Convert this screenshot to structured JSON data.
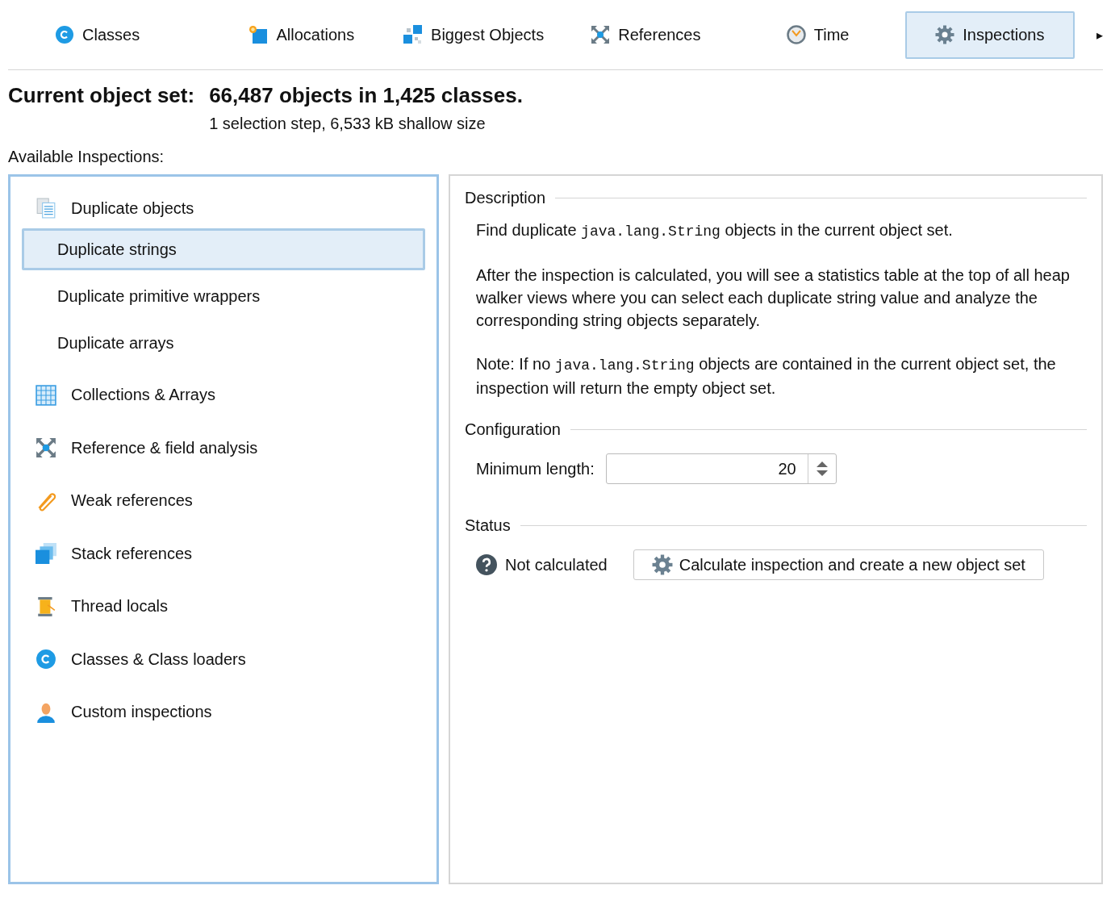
{
  "tabs": [
    {
      "label": "Classes",
      "selected": false
    },
    {
      "label": "Allocations",
      "selected": false
    },
    {
      "label": "Biggest Objects",
      "selected": false
    },
    {
      "label": "References",
      "selected": false
    },
    {
      "label": "Time",
      "selected": false
    },
    {
      "label": "Inspections",
      "selected": true
    }
  ],
  "tab_overflow": "▸",
  "header": {
    "label": "Current object set:",
    "summary": "66,487 objects in 1,425 classes.",
    "detail": "1 selection step, 6,533 kB shallow size"
  },
  "inspections": {
    "label": "Available Inspections:",
    "items": [
      {
        "label": "Duplicate objects",
        "selected": false,
        "children": [
          {
            "label": "Duplicate strings",
            "selected": true
          },
          {
            "label": "Duplicate primitive wrappers",
            "selected": false
          },
          {
            "label": "Duplicate arrays",
            "selected": false
          }
        ]
      },
      {
        "label": "Collections & Arrays",
        "selected": false
      },
      {
        "label": "Reference & field analysis",
        "selected": false
      },
      {
        "label": "Weak references",
        "selected": false
      },
      {
        "label": "Stack references",
        "selected": false
      },
      {
        "label": "Thread locals",
        "selected": false
      },
      {
        "label": "Classes & Class loaders",
        "selected": false
      },
      {
        "label": "Custom inspections",
        "selected": false
      }
    ]
  },
  "description": {
    "title": "Description",
    "paragraphs": [
      [
        {
          "kind": "text",
          "text": "Find duplicate "
        },
        {
          "kind": "code",
          "text": "java.lang.String"
        },
        {
          "kind": "text",
          "text": " objects in the current object set."
        }
      ],
      [
        {
          "kind": "text",
          "text": "After the inspection is calculated, you will see a statistics table at the top of all heap walker views where you can select each duplicate string value and analyze the corresponding string objects separately."
        }
      ],
      [
        {
          "kind": "text",
          "text": "Note: If no "
        },
        {
          "kind": "code",
          "text": "java.lang.String"
        },
        {
          "kind": "text",
          "text": " objects are contained in the current object set, the inspection will return the empty object set."
        }
      ]
    ]
  },
  "configuration": {
    "title": "Configuration",
    "label": "Minimum length:",
    "value": "20"
  },
  "status": {
    "title": "Status",
    "text": "Not calculated",
    "button": "Calculate inspection and create a new object set"
  }
}
